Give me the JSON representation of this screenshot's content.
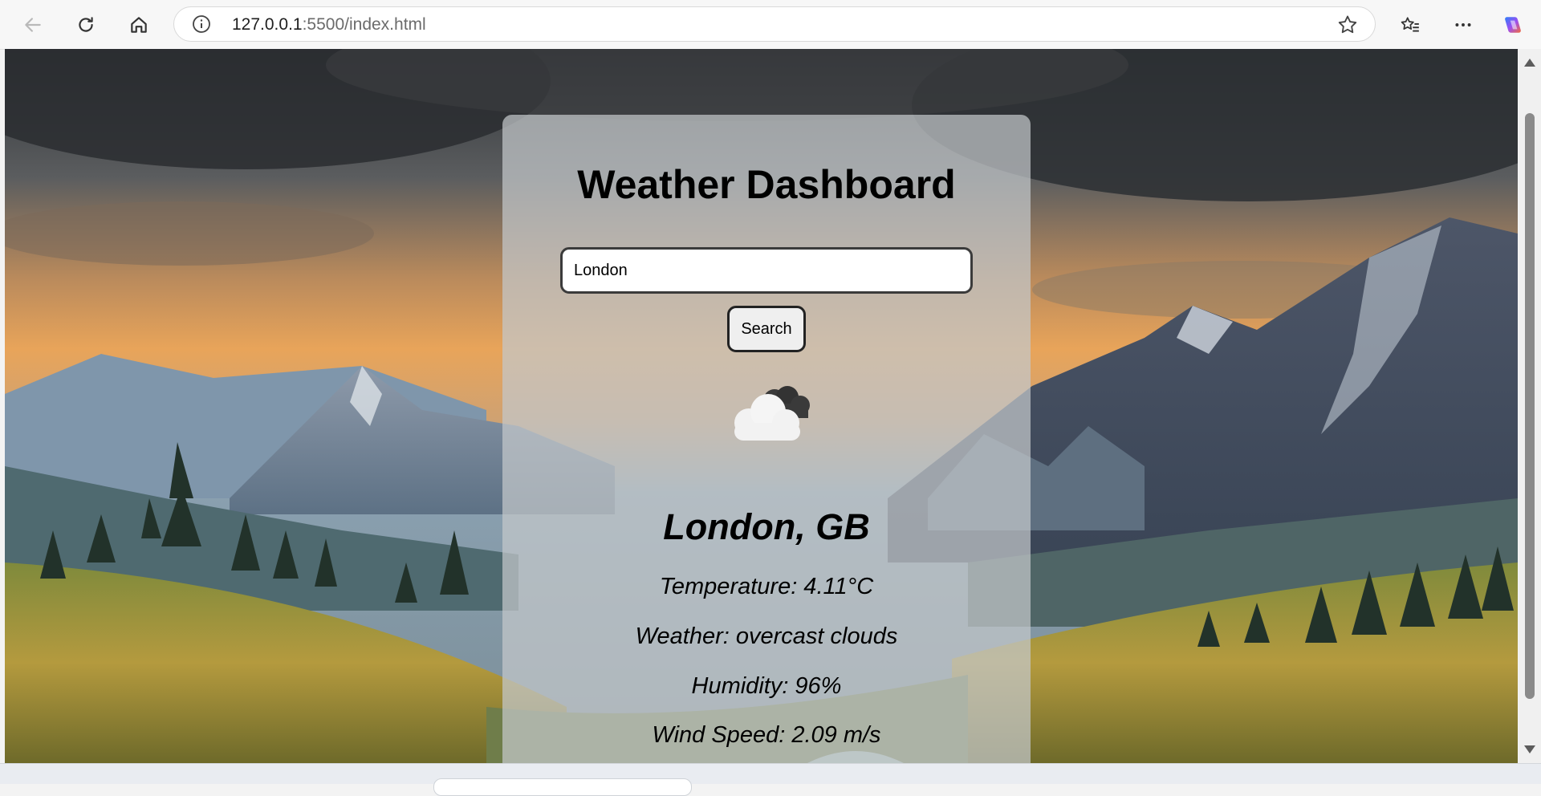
{
  "browser": {
    "url_host": "127.0.0.1",
    "url_path": ":5500/index.html"
  },
  "page": {
    "title": "Weather Dashboard",
    "search": {
      "value": "London",
      "button_label": "Search"
    },
    "weather_icon": "overcast-clouds-icon",
    "location": "London, GB",
    "stats": {
      "temperature": "Temperature: 4.11°C",
      "weather": "Weather: overcast clouds",
      "humidity": "Humidity: 96%",
      "wind": "Wind Speed: 2.09 m/s"
    }
  },
  "colors": {
    "card_background": "#c4c7cb",
    "button_background": "#efefef",
    "sky_top": "#2f3337",
    "sunset": "#e8a45a"
  }
}
